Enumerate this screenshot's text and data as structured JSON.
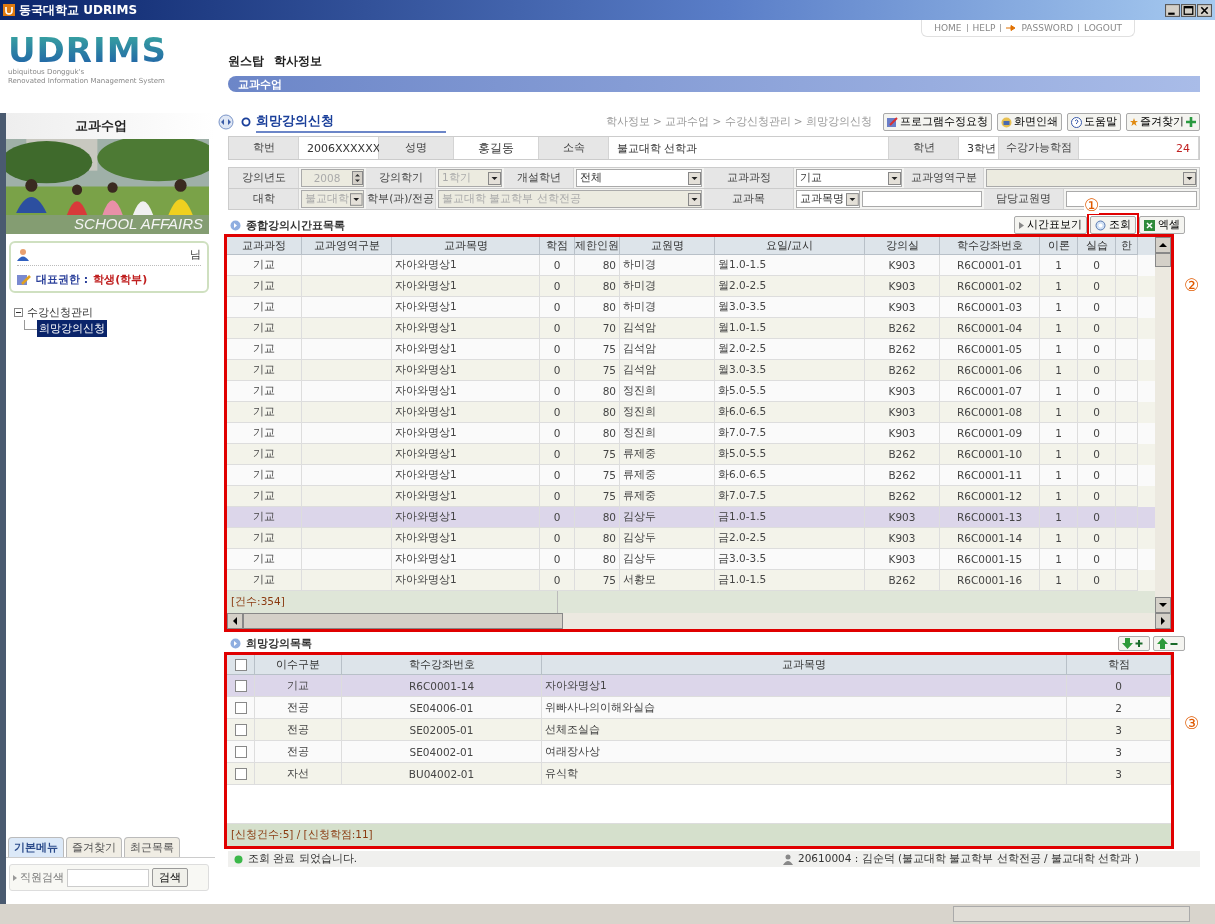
{
  "window": {
    "title": "동국대학교 UDRIMS"
  },
  "logo": {
    "name": "UDRIMS",
    "tagline": [
      "ubiquitous Dongguk's",
      "Renovated Information Management System"
    ]
  },
  "top_links": [
    {
      "label": "HOME",
      "kind": "plain"
    },
    {
      "label": "HELP",
      "kind": "plain"
    },
    {
      "label": "PASSWORD",
      "kind": "key"
    },
    {
      "label": "LOGOUT",
      "kind": "plain"
    }
  ],
  "top_menu": [
    "원스탑",
    "학사정보"
  ],
  "current_menu": "교과수업",
  "sidebar": {
    "title": "교과수업",
    "picture_caption": "SCHOOL AFFAIRS",
    "user_suffix": "님",
    "role_label": "대표권한 :",
    "role_value": "학생(학부)",
    "tree": [
      {
        "label": "수강신청관리",
        "expanded": true,
        "children": [
          {
            "label": "희망강의신청",
            "selected": true
          }
        ]
      }
    ],
    "tabs": [
      {
        "label": "기본메뉴",
        "selected": true
      },
      {
        "label": "즐겨찾기",
        "selected": false
      },
      {
        "label": "최근목록",
        "selected": false
      }
    ],
    "search": {
      "label": "직원검색",
      "button": "검색"
    }
  },
  "page": {
    "title": "희망강의신청",
    "breadcrumb": "학사정보 > 교과수업 > 수강신청관리 > 희망강의신청",
    "buttons": [
      {
        "label": "프로그램수정요청",
        "kind": "edit"
      },
      {
        "label": "화면인쇄",
        "kind": "print"
      },
      {
        "label": "도움말",
        "kind": "help"
      },
      {
        "label": "즐겨찾기",
        "kind": "favorite"
      }
    ]
  },
  "info_rows": [
    [
      {
        "kind": "label",
        "text": "학번"
      },
      {
        "kind": "text",
        "text": "2006XXXXXX"
      },
      {
        "kind": "label",
        "text": "성명"
      },
      {
        "kind": "text",
        "text": "홍길동",
        "center": true
      },
      {
        "kind": "label",
        "text": "소속"
      },
      {
        "kind": "text",
        "text": "불교대학 선학과"
      },
      {
        "kind": "label",
        "text": "학년"
      },
      {
        "kind": "text",
        "text": "3학년"
      },
      {
        "kind": "label",
        "text": "수강가능학점"
      },
      {
        "kind": "text",
        "text": "24",
        "accent": true
      }
    ],
    [
      {
        "kind": "label",
        "text": "강의년도"
      },
      {
        "kind": "spin",
        "text": "2008",
        "disabled": true
      },
      {
        "kind": "label",
        "text": "강의학기"
      },
      {
        "kind": "select",
        "text": "1학기",
        "disabled": true
      },
      {
        "kind": "label",
        "text": "개설학년"
      },
      {
        "kind": "select",
        "text": "전체",
        "disabled": false
      },
      {
        "kind": "label",
        "text": "교과과정"
      },
      {
        "kind": "select",
        "text": "기교",
        "disabled": false
      },
      {
        "kind": "label",
        "text": "교과영역구분"
      },
      {
        "kind": "select",
        "disabled": true
      }
    ],
    [
      {
        "kind": "label",
        "text": "대학"
      },
      {
        "kind": "select",
        "text": "불교대학",
        "disabled": true
      },
      {
        "kind": "label",
        "text": "학부(과)/전공"
      },
      {
        "kind": "select",
        "text": "불교대학 불교학부 선학전공",
        "disabled": true
      },
      {
        "kind": "label",
        "text": "교과목"
      },
      {
        "kind": "combo",
        "text": "교과목명",
        "disabled": false
      },
      {
        "kind": "label",
        "text": "담당교원명"
      },
      {
        "kind": "input",
        "disabled": false
      }
    ]
  ],
  "course_grid": {
    "title": "종합강의시간표목록",
    "marker": "②",
    "buttons": [
      {
        "label": "시간표보기",
        "kind": "view"
      },
      {
        "label": "조회",
        "kind": "search",
        "marker": "①"
      },
      {
        "label": "엑셀",
        "kind": "excel"
      }
    ],
    "columns": [
      "교과과정",
      "교과영역구분",
      "교과목명",
      "학점",
      "제한인원",
      "교원명",
      "요일/교시",
      "강의실",
      "학수강좌번호",
      "이론",
      "실습",
      "한"
    ],
    "rows": [
      {
        "cells": [
          "기교",
          "",
          "자아와명상1",
          "0",
          "80",
          "하미경",
          "월1.0-1.5",
          "K903",
          "R6C0001-01",
          "1",
          "0"
        ],
        "selected": false
      },
      {
        "cells": [
          "기교",
          "",
          "자아와명상1",
          "0",
          "80",
          "하미경",
          "월2.0-2.5",
          "K903",
          "R6C0001-02",
          "1",
          "0"
        ],
        "selected": false
      },
      {
        "cells": [
          "기교",
          "",
          "자아와명상1",
          "0",
          "80",
          "하미경",
          "월3.0-3.5",
          "K903",
          "R6C0001-03",
          "1",
          "0"
        ],
        "selected": false
      },
      {
        "cells": [
          "기교",
          "",
          "자아와명상1",
          "0",
          "70",
          "김석암",
          "월1.0-1.5",
          "B262",
          "R6C0001-04",
          "1",
          "0"
        ],
        "selected": false
      },
      {
        "cells": [
          "기교",
          "",
          "자아와명상1",
          "0",
          "75",
          "김석암",
          "월2.0-2.5",
          "B262",
          "R6C0001-05",
          "1",
          "0"
        ],
        "selected": false
      },
      {
        "cells": [
          "기교",
          "",
          "자아와명상1",
          "0",
          "75",
          "김석암",
          "월3.0-3.5",
          "B262",
          "R6C0001-06",
          "1",
          "0"
        ],
        "selected": false
      },
      {
        "cells": [
          "기교",
          "",
          "자아와명상1",
          "0",
          "80",
          "정진희",
          "화5.0-5.5",
          "K903",
          "R6C0001-07",
          "1",
          "0"
        ],
        "selected": false
      },
      {
        "cells": [
          "기교",
          "",
          "자아와명상1",
          "0",
          "80",
          "정진희",
          "화6.0-6.5",
          "K903",
          "R6C0001-08",
          "1",
          "0"
        ],
        "selected": false
      },
      {
        "cells": [
          "기교",
          "",
          "자아와명상1",
          "0",
          "80",
          "정진희",
          "화7.0-7.5",
          "K903",
          "R6C0001-09",
          "1",
          "0"
        ],
        "selected": false
      },
      {
        "cells": [
          "기교",
          "",
          "자아와명상1",
          "0",
          "75",
          "류제중",
          "화5.0-5.5",
          "B262",
          "R6C0001-10",
          "1",
          "0"
        ],
        "selected": false
      },
      {
        "cells": [
          "기교",
          "",
          "자아와명상1",
          "0",
          "75",
          "류제중",
          "화6.0-6.5",
          "B262",
          "R6C0001-11",
          "1",
          "0"
        ],
        "selected": false
      },
      {
        "cells": [
          "기교",
          "",
          "자아와명상1",
          "0",
          "75",
          "류제중",
          "화7.0-7.5",
          "B262",
          "R6C0001-12",
          "1",
          "0"
        ],
        "selected": false
      },
      {
        "cells": [
          "기교",
          "",
          "자아와명상1",
          "0",
          "80",
          "김상두",
          "금1.0-1.5",
          "K903",
          "R6C0001-13",
          "1",
          "0"
        ],
        "selected": true
      },
      {
        "cells": [
          "기교",
          "",
          "자아와명상1",
          "0",
          "80",
          "김상두",
          "금2.0-2.5",
          "K903",
          "R6C0001-14",
          "1",
          "0"
        ],
        "selected": false
      },
      {
        "cells": [
          "기교",
          "",
          "자아와명상1",
          "0",
          "80",
          "김상두",
          "금3.0-3.5",
          "K903",
          "R6C0001-15",
          "1",
          "0"
        ],
        "selected": false
      },
      {
        "cells": [
          "기교",
          "",
          "자아와명상1",
          "0",
          "75",
          "서황모",
          "금1.0-1.5",
          "B262",
          "R6C0001-16",
          "1",
          "0"
        ],
        "selected": false
      }
    ],
    "footer": "[건수:354]"
  },
  "wish_grid": {
    "title": "희망강의목록",
    "marker": "③",
    "header_checked": false,
    "columns": [
      "이수구분",
      "학수강좌번호",
      "교과목명",
      "학점"
    ],
    "rows": [
      {
        "checked": false,
        "selected": true,
        "cells": [
          "기교",
          "R6C0001-14",
          "자아와명상1",
          "0"
        ]
      },
      {
        "checked": false,
        "selected": false,
        "cells": [
          "전공",
          "SE04006-01",
          "위빠사나의이해와실습",
          "2"
        ]
      },
      {
        "checked": false,
        "selected": false,
        "cells": [
          "전공",
          "SE02005-01",
          "선체조실습",
          "3"
        ]
      },
      {
        "checked": false,
        "selected": false,
        "cells": [
          "전공",
          "SE04002-01",
          "여래장사상",
          "3"
        ]
      },
      {
        "checked": false,
        "selected": false,
        "cells": [
          "자선",
          "BU04002-01",
          "유식학",
          "3"
        ]
      }
    ],
    "footer": "[신청건수:5] / [신청학점:11]"
  },
  "status_bar": {
    "message": "조회 완료 되었습니다.",
    "user": "20610004 : 김순덕 (불교대학 불교학부 선학전공 / 불교대학 선학과 )"
  }
}
